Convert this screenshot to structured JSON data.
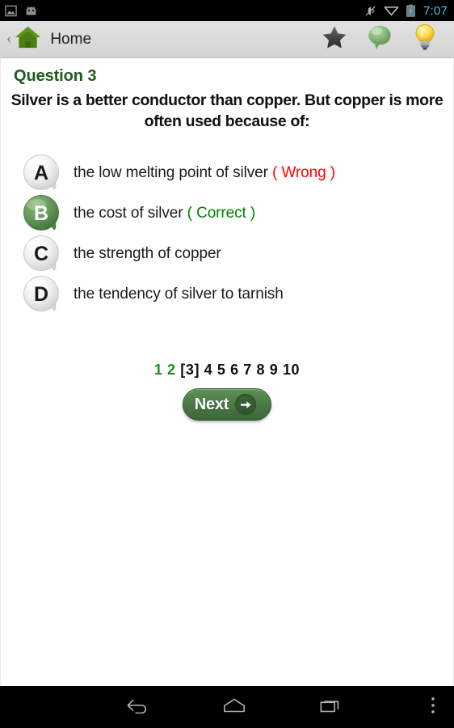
{
  "status_bar": {
    "left_icons": [
      "photo-icon",
      "android-head-icon"
    ],
    "right_icons": [
      "vibrate-off-icon",
      "wifi-icon",
      "battery-charging-icon"
    ],
    "time": "7:07",
    "accent_color": "#4fc3e8",
    "background": "#000000"
  },
  "action_bar": {
    "back_chevron": "‹",
    "home_icon": "home-icon",
    "title": "Home",
    "actions": [
      {
        "name": "favorite-star-icon",
        "label": "Favorite"
      },
      {
        "name": "comment-bubble-icon",
        "label": "Comments"
      },
      {
        "name": "hint-bulb-icon",
        "label": "Hint"
      }
    ]
  },
  "quiz": {
    "question_number_label": "Question 3",
    "question_text": "Silver is a better conductor than copper. But copper is more often used because of:",
    "header_color": "#1d5c1d",
    "options": [
      {
        "letter": "A",
        "text": "the low melting point of silver",
        "verdict": "( Wrong )",
        "verdict_type": "wrong",
        "state": "selected-wrong",
        "bubble_color": "#e8e8e8"
      },
      {
        "letter": "B",
        "text": "the cost of silver",
        "verdict": "( Correct )",
        "verdict_type": "correct",
        "state": "correct",
        "bubble_color": "#5d9152"
      },
      {
        "letter": "C",
        "text": "the strength of copper",
        "verdict": "",
        "verdict_type": "none",
        "state": "default",
        "bubble_color": "#e8e8e8"
      },
      {
        "letter": "D",
        "text": "the tendency of silver to tarnish",
        "verdict": "",
        "verdict_type": "none",
        "state": "default",
        "bubble_color": "#e8e8e8"
      }
    ],
    "verdict_colors": {
      "wrong": "#ff0000",
      "correct": "#008000"
    },
    "pagination": {
      "visited": [
        "1",
        "2"
      ],
      "current": "[3]",
      "upcoming": [
        "4",
        "5",
        "6",
        "7",
        "8",
        "9",
        "10"
      ],
      "visited_color": "#1e8b1e"
    },
    "next_button": {
      "label": "Next",
      "icon": "arrow-right-icon",
      "color": "#4c7a46"
    }
  },
  "nav_bar": {
    "buttons": [
      {
        "name": "nav-back-icon",
        "label": "Back"
      },
      {
        "name": "nav-home-icon",
        "label": "Home"
      },
      {
        "name": "nav-recents-icon",
        "label": "Recents"
      },
      {
        "name": "nav-overflow-icon",
        "label": "More options"
      }
    ]
  }
}
